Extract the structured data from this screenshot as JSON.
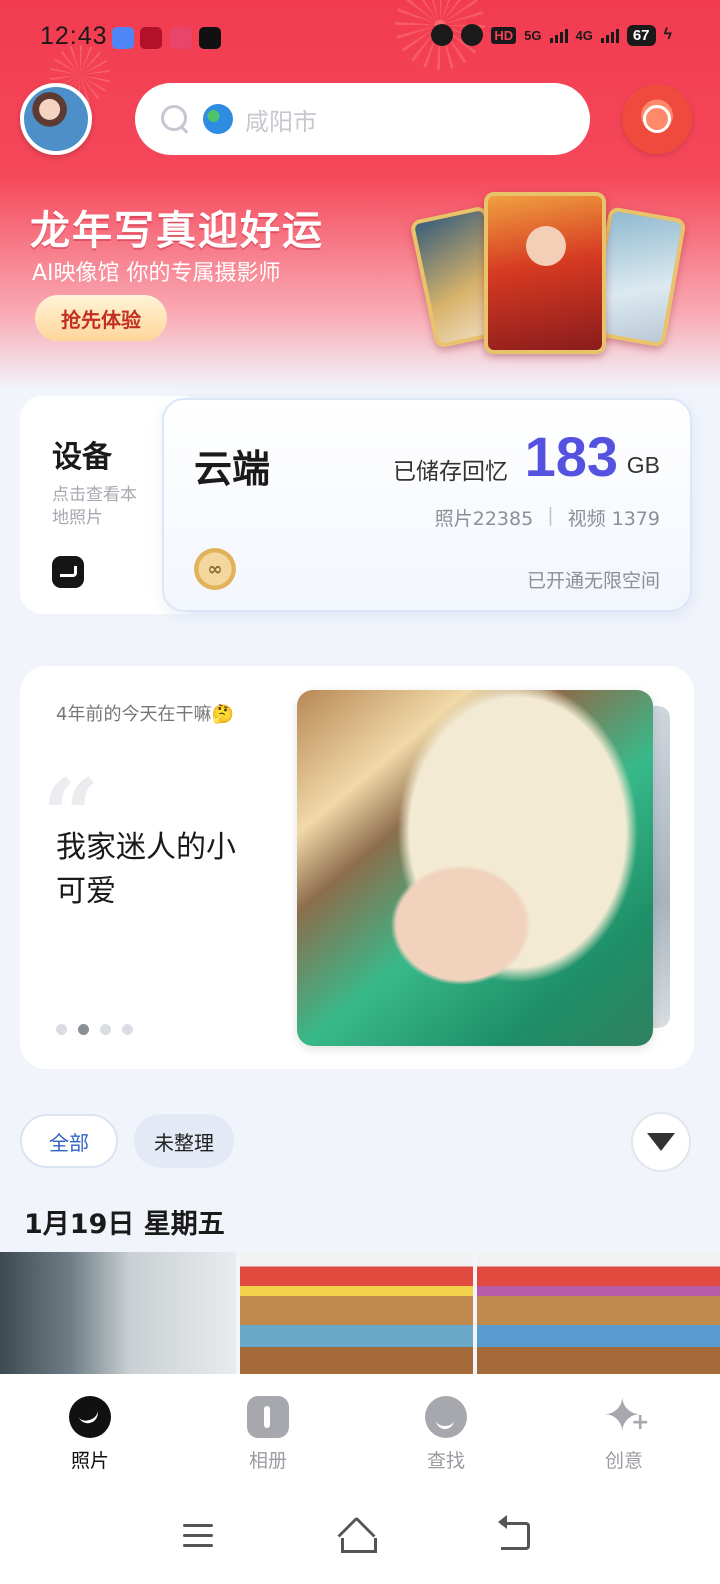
{
  "status_bar": {
    "time": "12:43",
    "hd": "HD",
    "net1": "5G",
    "net2": "4G",
    "battery": "67",
    "icons": [
      "cloud-app-icon",
      "red-app-icon",
      "pink-app-icon",
      "tiktok-icon",
      "alarm-icon",
      "mute-icon",
      "charging-icon"
    ]
  },
  "header": {
    "search_location": "咸阳市",
    "icons": [
      "avatar",
      "search-icon",
      "globe-icon",
      "red-envelope-gift-icon"
    ]
  },
  "banner": {
    "title": "龙年写真迎好运",
    "subtitle": "AI映像馆 你的专属摄影师",
    "button": "抢先体验"
  },
  "storage": {
    "device_title": "设备",
    "device_desc": "点击查看本地照片",
    "cloud_title": "云端",
    "stored_label": "已储存回忆",
    "stored_value": "183",
    "stored_unit": "GB",
    "photos": "照片22385",
    "videos": "视频 1379",
    "separator": "|",
    "unlimited": "已开通无限空间",
    "medal_symbol": "∞"
  },
  "memory": {
    "date_text": "4年前的今天在干嘛🤔",
    "quote_mark": "“",
    "title": "我家迷人的小可爱",
    "page_count": 4,
    "active_page": 1
  },
  "filters": {
    "chips": [
      "全部",
      "未整理"
    ],
    "active": "全部"
  },
  "gallery": {
    "date_heading": "1月19日 星期五",
    "thumbnails": [
      "photo-1",
      "photo-2",
      "photo-3"
    ]
  },
  "tabs": [
    {
      "label": "照片",
      "icon": "photos-icon",
      "active": true
    },
    {
      "label": "相册",
      "icon": "albums-icon",
      "active": false
    },
    {
      "label": "查找",
      "icon": "find-icon",
      "active": false
    },
    {
      "label": "创意",
      "icon": "create-sparkle-icon",
      "active": false
    }
  ],
  "colors": {
    "brand_red": "#f23b50",
    "accent_purple": "#5552e0",
    "chip_blue": "#2f63c8"
  }
}
